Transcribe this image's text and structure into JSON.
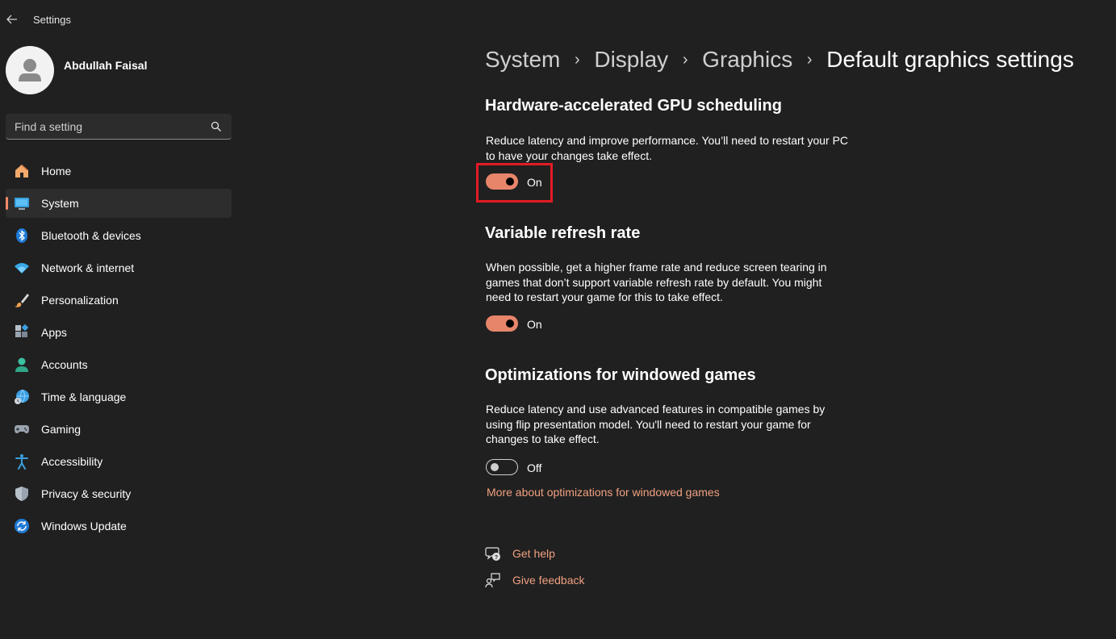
{
  "window": {
    "title": "Settings"
  },
  "user": {
    "name": "Abdullah Faisal"
  },
  "search": {
    "placeholder": "Find a setting"
  },
  "nav": [
    {
      "label": "Home",
      "icon": "home-icon"
    },
    {
      "label": "System",
      "icon": "monitor-icon",
      "active": true
    },
    {
      "label": "Bluetooth & devices",
      "icon": "bluetooth-icon"
    },
    {
      "label": "Network & internet",
      "icon": "wifi-icon"
    },
    {
      "label": "Personalization",
      "icon": "brush-icon"
    },
    {
      "label": "Apps",
      "icon": "apps-icon"
    },
    {
      "label": "Accounts",
      "icon": "person-icon"
    },
    {
      "label": "Time & language",
      "icon": "globe-clock-icon"
    },
    {
      "label": "Gaming",
      "icon": "gamepad-icon"
    },
    {
      "label": "Accessibility",
      "icon": "accessibility-icon"
    },
    {
      "label": "Privacy & security",
      "icon": "shield-icon"
    },
    {
      "label": "Windows Update",
      "icon": "update-icon"
    }
  ],
  "breadcrumb": [
    "System",
    "Display",
    "Graphics",
    "Default graphics settings"
  ],
  "sections": {
    "gpu": {
      "title": "Hardware-accelerated GPU scheduling",
      "description": "Reduce latency and improve performance. You’ll need to restart your PC to have your changes take effect.",
      "state": "On"
    },
    "vrr": {
      "title": "Variable refresh rate",
      "description": "When possible, get a higher frame rate and reduce screen tearing in games that don’t support variable refresh rate by default. You might need to restart your game for this to take effect.",
      "state": "On"
    },
    "windowed": {
      "title": "Optimizations for windowed games",
      "description": "Reduce latency and use advanced features in compatible games by using flip presentation model. You'll need to restart your game for changes to take effect.",
      "state": "Off",
      "link": "More about optimizations for windowed games"
    }
  },
  "help": {
    "get_help": "Get help",
    "give_feedback": "Give feedback"
  },
  "colors": {
    "accent": "#e7856a",
    "link": "#f0a080",
    "background": "#202020",
    "highlight": "#e21b23"
  }
}
